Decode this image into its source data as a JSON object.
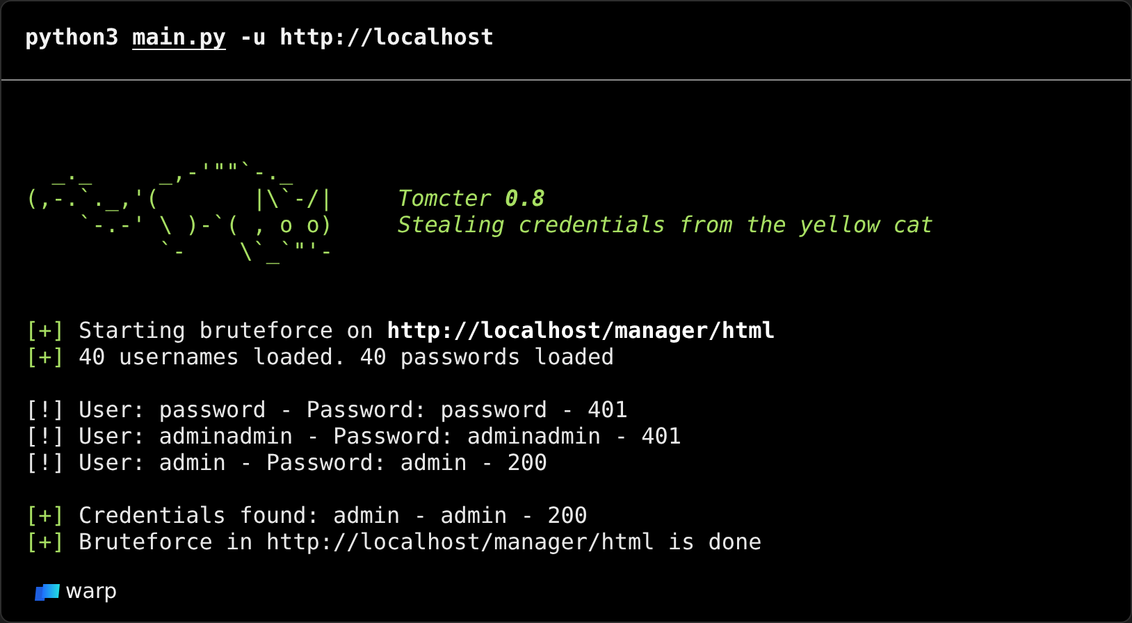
{
  "command": {
    "program": "python3",
    "file": "main.py",
    "args": "-u http://localhost"
  },
  "banner": {
    "art": [
      "  _._     _,-'\"\"`-._",
      "(,-.`._,'(       |\\`-/|",
      "    `-.-' \\ )-`( , o o)",
      "          `-    \\`_`\"'-"
    ],
    "title": "Tomcter",
    "version": "0.8",
    "tagline": "Stealing credentials from the yellow cat"
  },
  "log_groups": [
    [
      {
        "kind": "info",
        "prefix": "[+]",
        "text": "Starting bruteforce on **http://localhost/manager/html**"
      },
      {
        "kind": "info",
        "prefix": "[+]",
        "text": "40 usernames loaded. 40 passwords loaded"
      }
    ],
    [
      {
        "kind": "attempt",
        "prefix": "[!]",
        "text": "User: password - Password: password - 401"
      },
      {
        "kind": "attempt",
        "prefix": "[!]",
        "text": "User: adminadmin - Password: adminadmin - 401"
      },
      {
        "kind": "attempt",
        "prefix": "[!]",
        "text": "User: admin - Password: admin - 200"
      }
    ],
    [
      {
        "kind": "info",
        "prefix": "[+]",
        "text": "Credentials found: admin - admin - 200"
      },
      {
        "kind": "info",
        "prefix": "[+]",
        "text": "Bruteforce in http://localhost/manager/html is done"
      }
    ]
  ],
  "footer": {
    "brand": "warp"
  }
}
